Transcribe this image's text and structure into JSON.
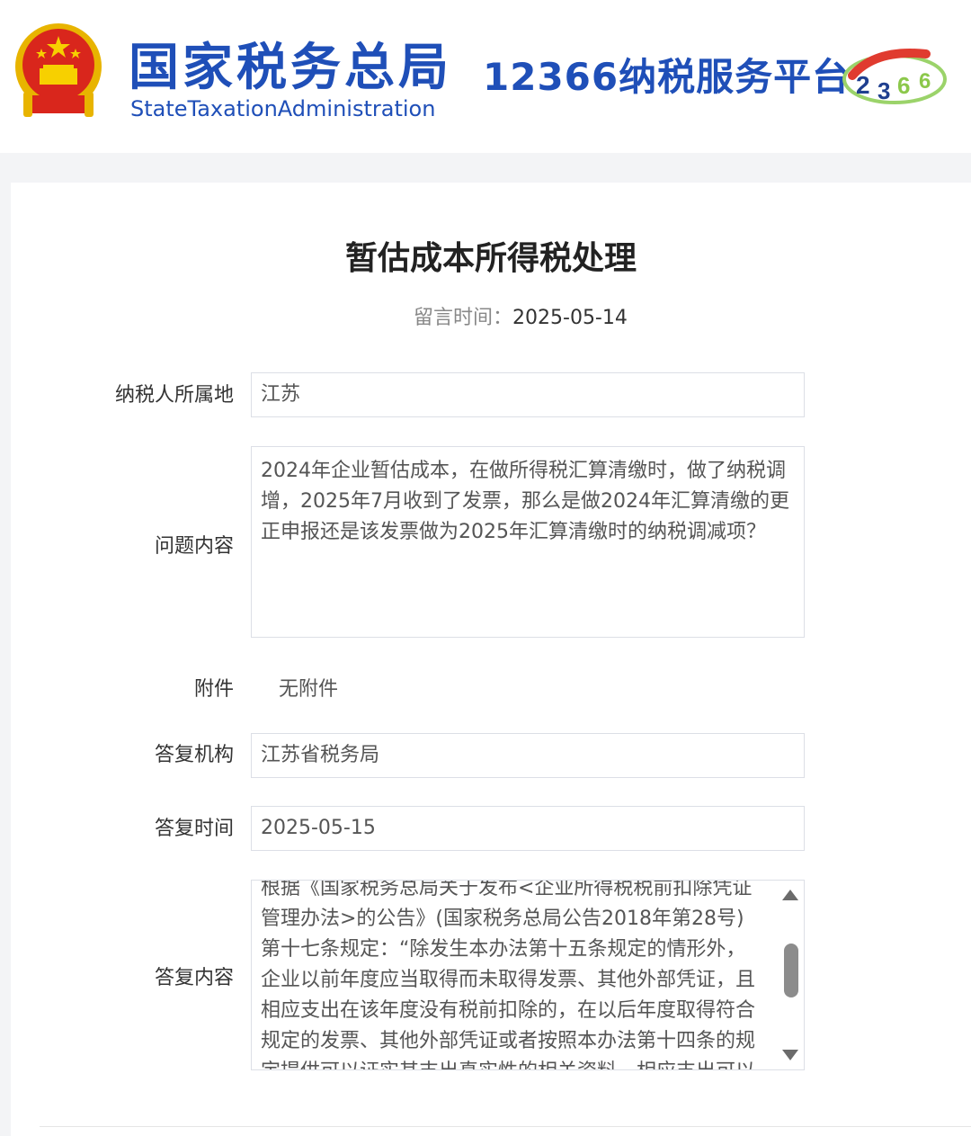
{
  "header": {
    "brand_cn": "国家税务总局",
    "brand_en": "StateTaxationAdministration",
    "platform": "12366纳税服务平台",
    "logo_icon": "12366-logo-icon",
    "emblem_icon": "national-emblem-icon",
    "brand_color": "#1f4fb8"
  },
  "page": {
    "title": "暂估成本所得税处理",
    "meta_label": "留言时间：",
    "meta_value": "2025-05-14"
  },
  "form": {
    "region_label": "纳税人所属地",
    "region_value": "江苏",
    "question_label": "问题内容",
    "question_value": "2024年企业暂估成本，在做所得税汇算清缴时，做了纳税调增，2025年7月收到了发票，那么是做2024年汇算清缴的更正申报还是该发票做为2025年汇算清缴时的纳税调减项？",
    "attachment_label": "附件",
    "attachment_value": "无附件",
    "agency_label": "答复机构",
    "agency_value": "江苏省税务局",
    "reply_time_label": "答复时间",
    "reply_time_value": "2025-05-15",
    "reply_label": "答复内容",
    "reply_value": "根据《国家税务总局关于发布<企业所得税税前扣除凭证管理办法>的公告》(国家税务总局公告2018年第28号)第十七条规定：“除发生本办法第十五条规定的情形外，企业以前年度应当取得而未取得发票、其他外部凭证，且相应支出在该年度没有税前扣除的，在以后年度取得符合规定的发票、其他外部凭证或者按照本办法第十四条的规定提供可以证实其支出真实性的相关资料，相应支出可以追"
  }
}
